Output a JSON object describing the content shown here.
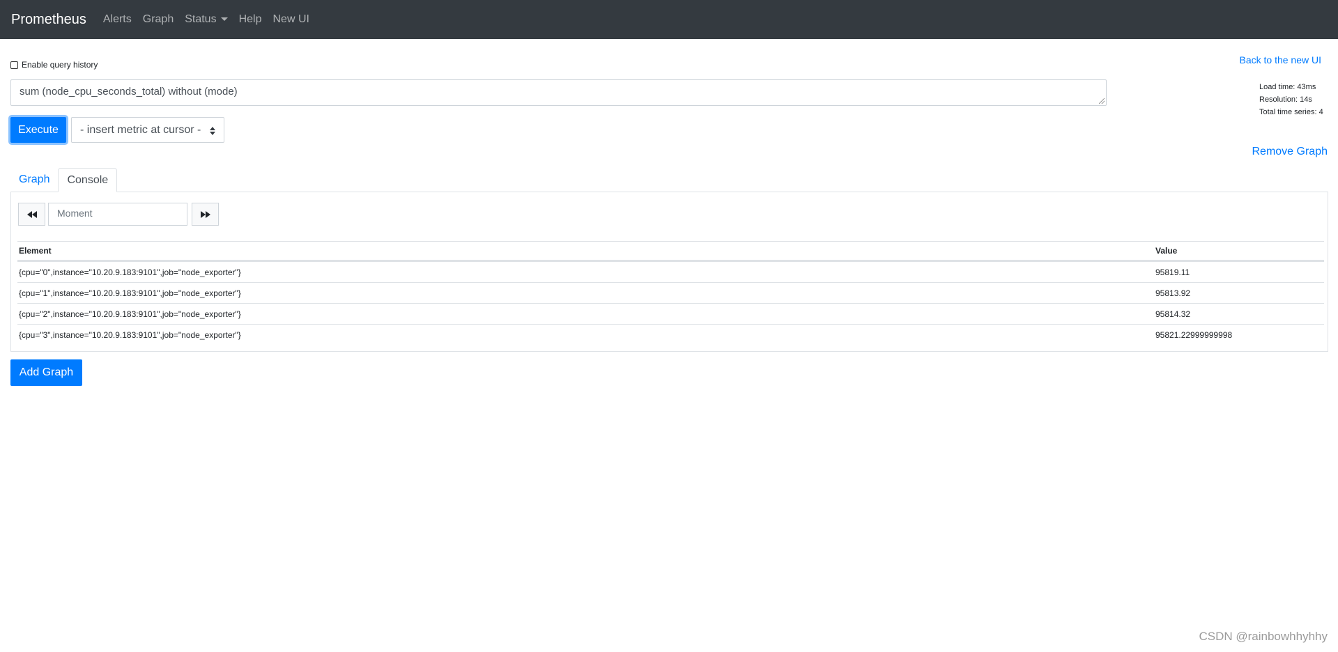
{
  "nav": {
    "brand": "Prometheus",
    "items": [
      "Alerts",
      "Graph",
      "Status",
      "Help",
      "New UI"
    ]
  },
  "query_history_label": "Enable query history",
  "back_link": "Back to the new UI",
  "stats": {
    "load_time": "Load time: 43ms",
    "resolution": "Resolution: 14s",
    "total_series": "Total time series: 4"
  },
  "expression": "sum (node_cpu_seconds_total) without (mode)",
  "execute_label": "Execute",
  "metric_select": "- insert metric at cursor -",
  "remove_graph": "Remove Graph",
  "tabs": [
    "Graph",
    "Console"
  ],
  "moment_placeholder": "Moment",
  "table": {
    "headers": [
      "Element",
      "Value"
    ],
    "rows": [
      [
        "{cpu=\"0\",instance=\"10.20.9.183:9101\",job=\"node_exporter\"}",
        "95819.11"
      ],
      [
        "{cpu=\"1\",instance=\"10.20.9.183:9101\",job=\"node_exporter\"}",
        "95813.92"
      ],
      [
        "{cpu=\"2\",instance=\"10.20.9.183:9101\",job=\"node_exporter\"}",
        "95814.32"
      ],
      [
        "{cpu=\"3\",instance=\"10.20.9.183:9101\",job=\"node_exporter\"}",
        "95821.22999999998"
      ]
    ]
  },
  "add_graph": "Add Graph",
  "watermark": "CSDN @rainbowhhyhhy",
  "colors": {
    "navbar": "#343a40",
    "primary": "#007bff"
  },
  "icons": [
    "backward-icon",
    "forward-icon",
    "caret-down-icon",
    "select-arrows-icon"
  ]
}
